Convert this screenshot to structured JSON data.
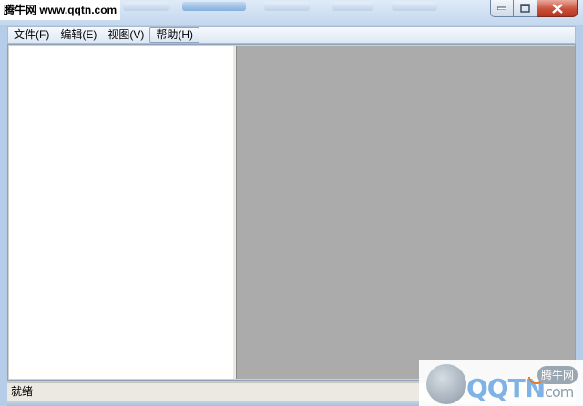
{
  "window": {
    "title": "腾牛网 www.qqtn.com"
  },
  "menubar": {
    "items": [
      {
        "label": "文件(F)"
      },
      {
        "label": "编辑(E)"
      },
      {
        "label": "视图(V)"
      },
      {
        "label": "帮助(H)"
      }
    ]
  },
  "statusbar": {
    "text": "就绪"
  },
  "watermark": {
    "logo_text": "QQTN",
    "logo_suffix": "com",
    "badge": "腾牛网"
  },
  "colors": {
    "left_pane": "#ffffff",
    "right_pane": "#ababab",
    "close_button": "#c8503a"
  }
}
